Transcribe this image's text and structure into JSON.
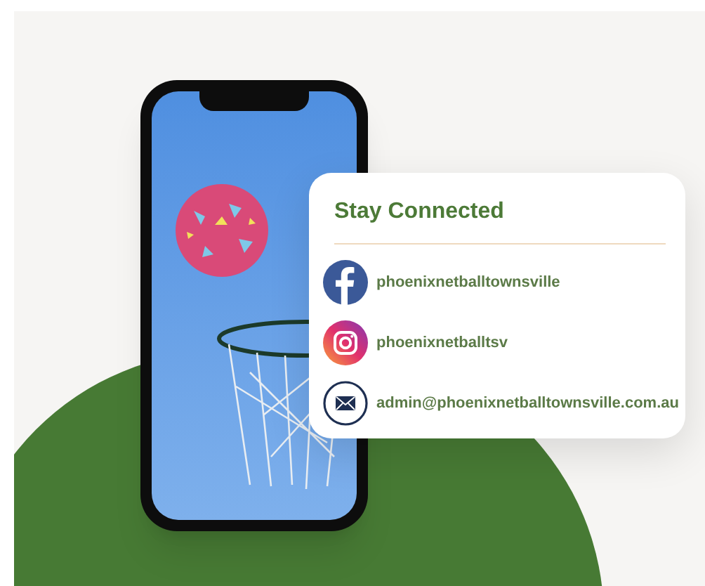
{
  "card": {
    "title": "Stay Connected",
    "links": [
      {
        "kind": "facebook",
        "label": "phoenixnetballtownsville"
      },
      {
        "kind": "instagram",
        "label": "phoenixnetballtsv"
      },
      {
        "kind": "email",
        "label": "admin@phoenixnetballtownsville.com.au"
      }
    ]
  }
}
